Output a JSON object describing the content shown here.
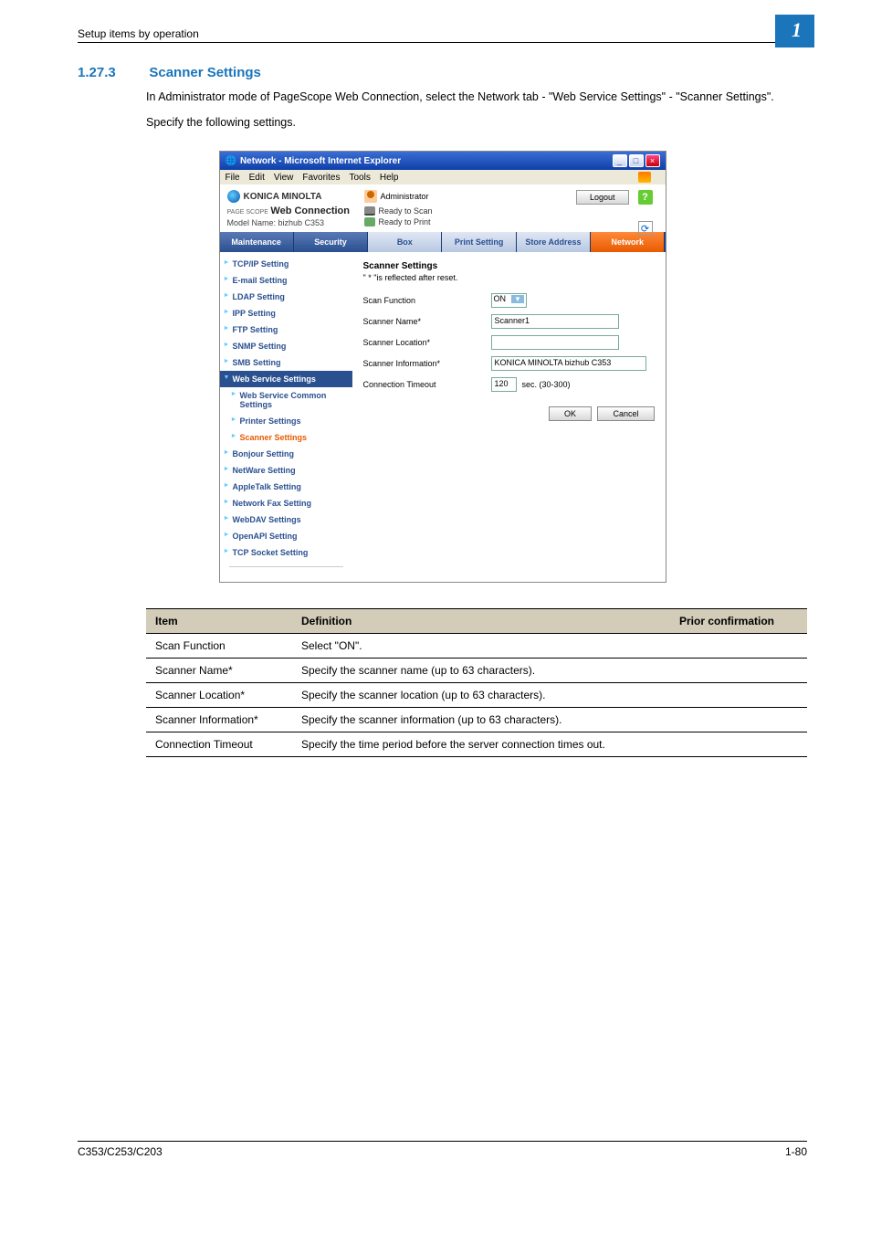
{
  "page_header": "Setup items by operation",
  "chapter_badge": "1",
  "section_number": "1.27.3",
  "section_title": "Scanner Settings",
  "intro1": "In Administrator mode of PageScope Web Connection, select the Network tab - \"Web Service Settings\" - \"Scanner Settings\".",
  "intro2": "Specify the following settings.",
  "window": {
    "title": "Network - Microsoft Internet Explorer",
    "menu": [
      "File",
      "Edit",
      "View",
      "Favorites",
      "Tools",
      "Help"
    ],
    "brand": "KONICA MINOLTA",
    "wc_prefix": "PAGE SCOPE",
    "wc_main": "Web Connection",
    "model": "Model Name: bizhub C353",
    "admin": "Administrator",
    "status1": "Ready to Scan",
    "status2": "Ready to Print",
    "logout": "Logout",
    "tabs": [
      "Maintenance",
      "Security",
      "Box",
      "Print Setting",
      "Store Address",
      "Network"
    ],
    "sidebar": {
      "items": [
        "TCP/IP Setting",
        "E-mail Setting",
        "LDAP Setting",
        "IPP Setting",
        "FTP Setting",
        "SNMP Setting",
        "SMB Setting"
      ],
      "open_item": "Web Service Settings",
      "subs": [
        "Web Service Common Settings",
        "Printer Settings",
        "Scanner Settings"
      ],
      "items2": [
        "Bonjour Setting",
        "NetWare Setting",
        "AppleTalk Setting",
        "Network Fax Setting",
        "WebDAV Settings",
        "OpenAPI Setting",
        "TCP Socket Setting"
      ]
    },
    "form": {
      "heading": "Scanner Settings",
      "note": "\" * \"is reflected after reset.",
      "rows": {
        "scan_function": {
          "label": "Scan Function",
          "value": "ON"
        },
        "scanner_name": {
          "label": "Scanner Name*",
          "value": "Scanner1"
        },
        "scanner_location": {
          "label": "Scanner Location*",
          "value": ""
        },
        "scanner_info": {
          "label": "Scanner Information*",
          "value": "KONICA MINOLTA bizhub C353"
        },
        "timeout": {
          "label": "Connection Timeout",
          "value": "120",
          "unit": "sec. (30-300)"
        }
      },
      "ok": "OK",
      "cancel": "Cancel"
    }
  },
  "table": {
    "headers": [
      "Item",
      "Definition",
      "Prior confirmation"
    ],
    "rows": [
      {
        "item": "Scan Function",
        "def": "Select \"ON\".",
        "pc": ""
      },
      {
        "item": "Scanner Name*",
        "def": "Specify the scanner name (up to 63 characters).",
        "pc": ""
      },
      {
        "item": "Scanner Location*",
        "def": "Specify the scanner location (up to 63 characters).",
        "pc": ""
      },
      {
        "item": "Scanner Information*",
        "def": "Specify the scanner information (up to 63 characters).",
        "pc": ""
      },
      {
        "item": "Connection Timeout",
        "def": "Specify the time period before the server connection times out.",
        "pc": ""
      }
    ]
  },
  "footer_left": "C353/C253/C203",
  "footer_right": "1-80"
}
